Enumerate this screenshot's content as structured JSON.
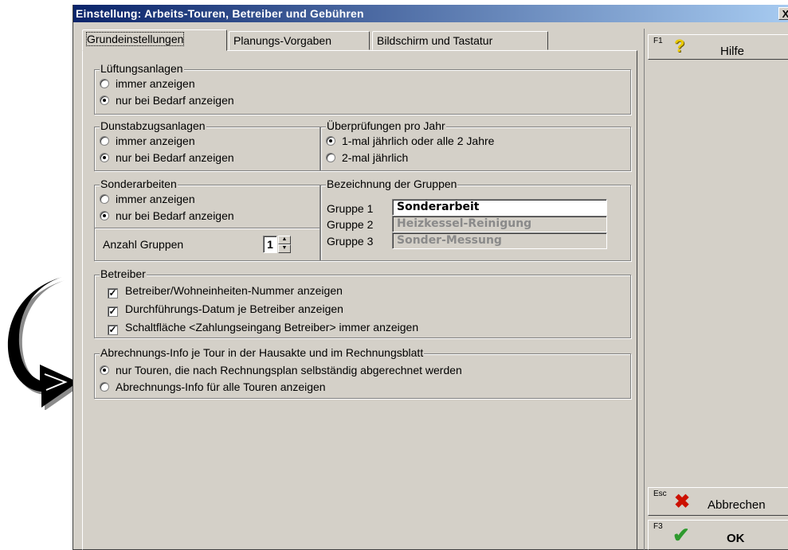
{
  "window": {
    "title": "Einstellung: Arbeits-Touren, Betreiber und Gebühren",
    "close": "X"
  },
  "tabs": [
    {
      "label": "Grundeinstellungen",
      "active": true
    },
    {
      "label": "Planungs-Vorgaben",
      "active": false
    },
    {
      "label": "Bildschirm und Tastatur",
      "active": false
    }
  ],
  "lueftung": {
    "legend": "Lüftungsanlagen",
    "options": [
      "immer anzeigen",
      "nur bei Bedarf anzeigen"
    ],
    "selected": 1
  },
  "dunst": {
    "legend": "Dunstabzugsanlagen",
    "options": [
      "immer anzeigen",
      "nur bei Bedarf anzeigen"
    ],
    "selected": 1
  },
  "pruef": {
    "legend": "Überprüfungen pro Jahr",
    "options": [
      "1-mal jährlich oder alle 2 Jahre",
      "2-mal jährlich"
    ],
    "selected": 0
  },
  "sonder": {
    "legend": "Sonderarbeiten",
    "options": [
      "immer anzeigen",
      "nur bei Bedarf anzeigen"
    ],
    "selected": 1,
    "anzahl_label": "Anzahl Gruppen",
    "anzahl_value": "1"
  },
  "gruppen": {
    "legend": "Bezeichnung der Gruppen",
    "items": [
      {
        "label": "Gruppe 1",
        "value": "Sonderarbeit",
        "enabled": true
      },
      {
        "label": "Gruppe 2",
        "value": "Heizkessel-Reinigung",
        "enabled": false
      },
      {
        "label": "Gruppe 3",
        "value": "Sonder-Messung",
        "enabled": false
      }
    ]
  },
  "betreiber": {
    "legend": "Betreiber",
    "checks": [
      {
        "label": "Betreiber/Wohneinheiten-Nummer anzeigen",
        "checked": true
      },
      {
        "label": "Durchführungs-Datum je Betreiber anzeigen",
        "checked": true
      },
      {
        "label": "Schaltfläche <Zahlungseingang Betreiber> immer anzeigen",
        "checked": true
      }
    ]
  },
  "abrechnung": {
    "legend": "Abrechnungs-Info je Tour in der Hausakte und im Rechnungsblatt",
    "options": [
      "nur Touren, die nach Rechnungsplan selbständig abgerechnet werden",
      "Abrechnungs-Info für alle Touren anzeigen"
    ],
    "selected": 0
  },
  "buttons": {
    "help": {
      "key": "F1",
      "label": "Hilfe"
    },
    "cancel": {
      "key": "Esc",
      "label": "Abbrechen"
    },
    "ok": {
      "key": "F3",
      "label": "OK"
    }
  },
  "colors": {
    "dialog_bg": "#d4d0c8",
    "title_start": "#0a246a",
    "title_end": "#a6caf0",
    "help_icon": "#e8c800",
    "cancel_icon": "#cc1100",
    "ok_icon": "#2e9a2e"
  }
}
